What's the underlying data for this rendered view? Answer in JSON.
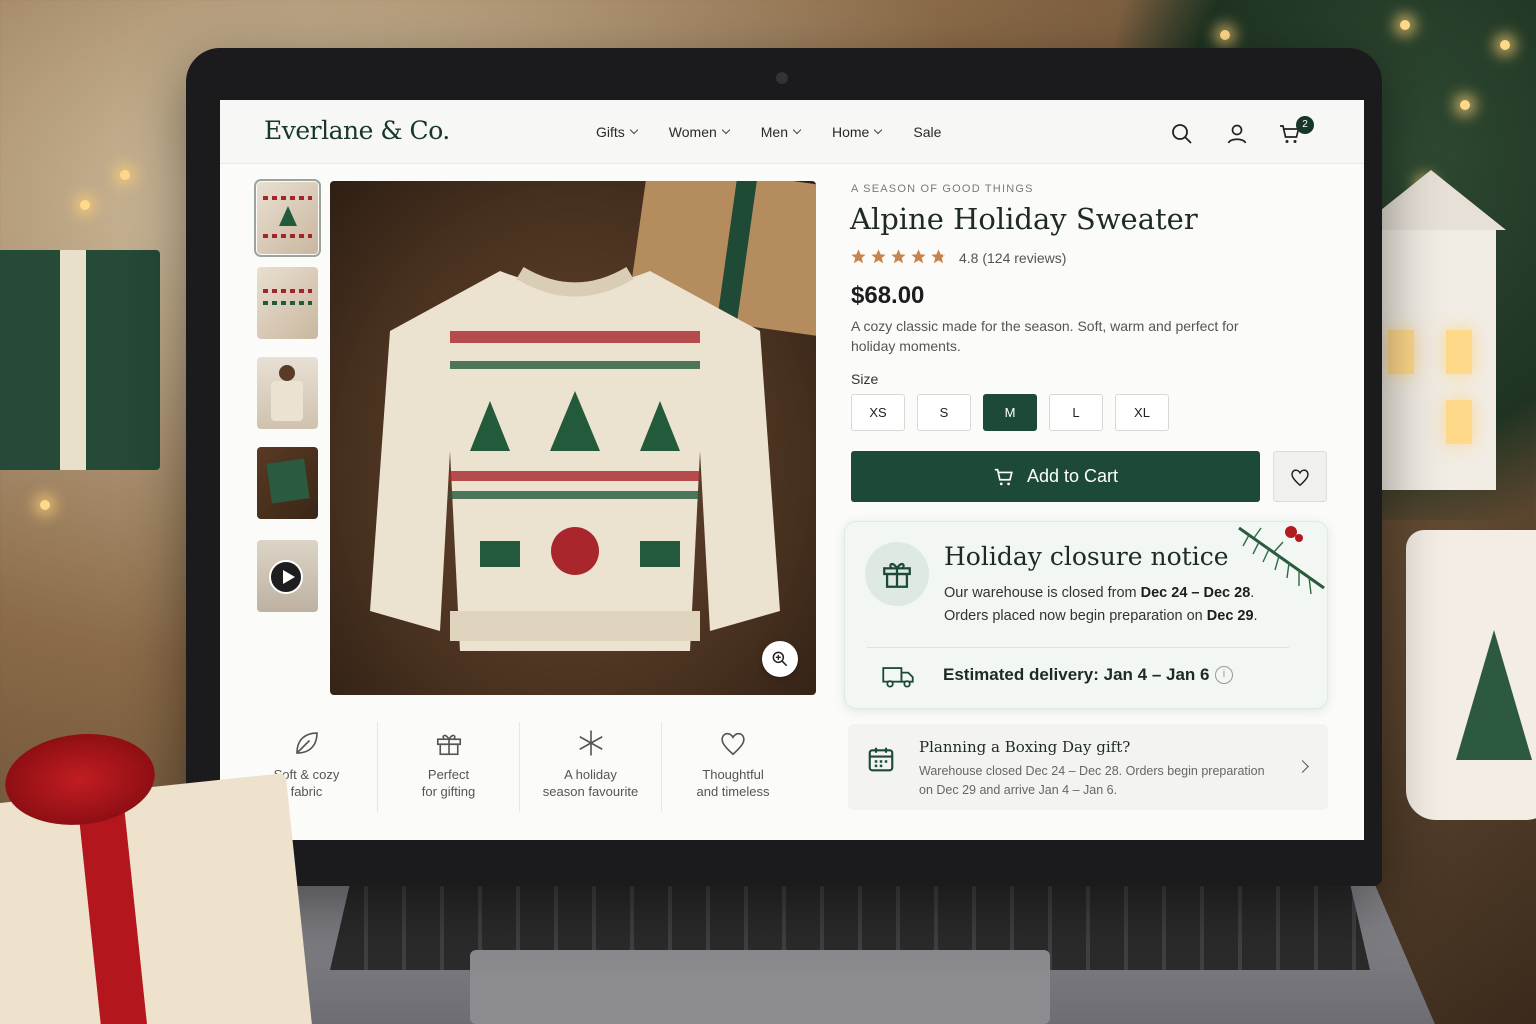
{
  "nav": {
    "brand": "Everlane & Co.",
    "links": [
      "Gifts",
      "Women",
      "Men",
      "Home",
      "Sale"
    ],
    "cart_count": "2"
  },
  "product": {
    "eyebrow": "A SEASON OF GOOD THINGS",
    "title": "Alpine Holiday Sweater",
    "rating": 4.8,
    "rating_text": "4.8 (124 reviews)",
    "price": "$68.00",
    "description": "A cozy classic made for the season. Soft, warm and perfect for holiday moments.",
    "size_label": "Size",
    "sizes": [
      "XS",
      "S",
      "M",
      "L",
      "XL"
    ],
    "selected_size": "M",
    "add_to_cart": "Add to Cart"
  },
  "features": [
    {
      "line1": "Soft & cozy",
      "line2": "fabric",
      "icon": "leaf-icon"
    },
    {
      "line1": "Perfect",
      "line2": "for gifting",
      "icon": "gift-icon"
    },
    {
      "line1": "A holiday",
      "line2": "season favourite",
      "icon": "snowflake-icon"
    },
    {
      "line1": "Thoughtful",
      "line2": "and timeless",
      "icon": "heart-icon"
    }
  ],
  "notice": {
    "title": "Holiday closure notice",
    "line1_pre": "Our warehouse is closed from ",
    "line1_bold": "Dec 24 – Dec 28",
    "line1_post": ".",
    "line2_pre": "Orders placed now begin preparation on ",
    "line2_bold": "Dec 29",
    "line2_post": ".",
    "delivery": "Estimated delivery: Jan 4 – Jan 6",
    "info": "i"
  },
  "boxing": {
    "title": "Planning a Boxing Day gift?",
    "body": "Warehouse closed Dec 24 – Dec 28. Orders begin preparation on Dec 29 and arrive Jan 4 – Jan 6."
  },
  "colors": {
    "accent": "#1d4a37",
    "star": "#c8834a",
    "notice_bg": "#f2f7f4"
  }
}
